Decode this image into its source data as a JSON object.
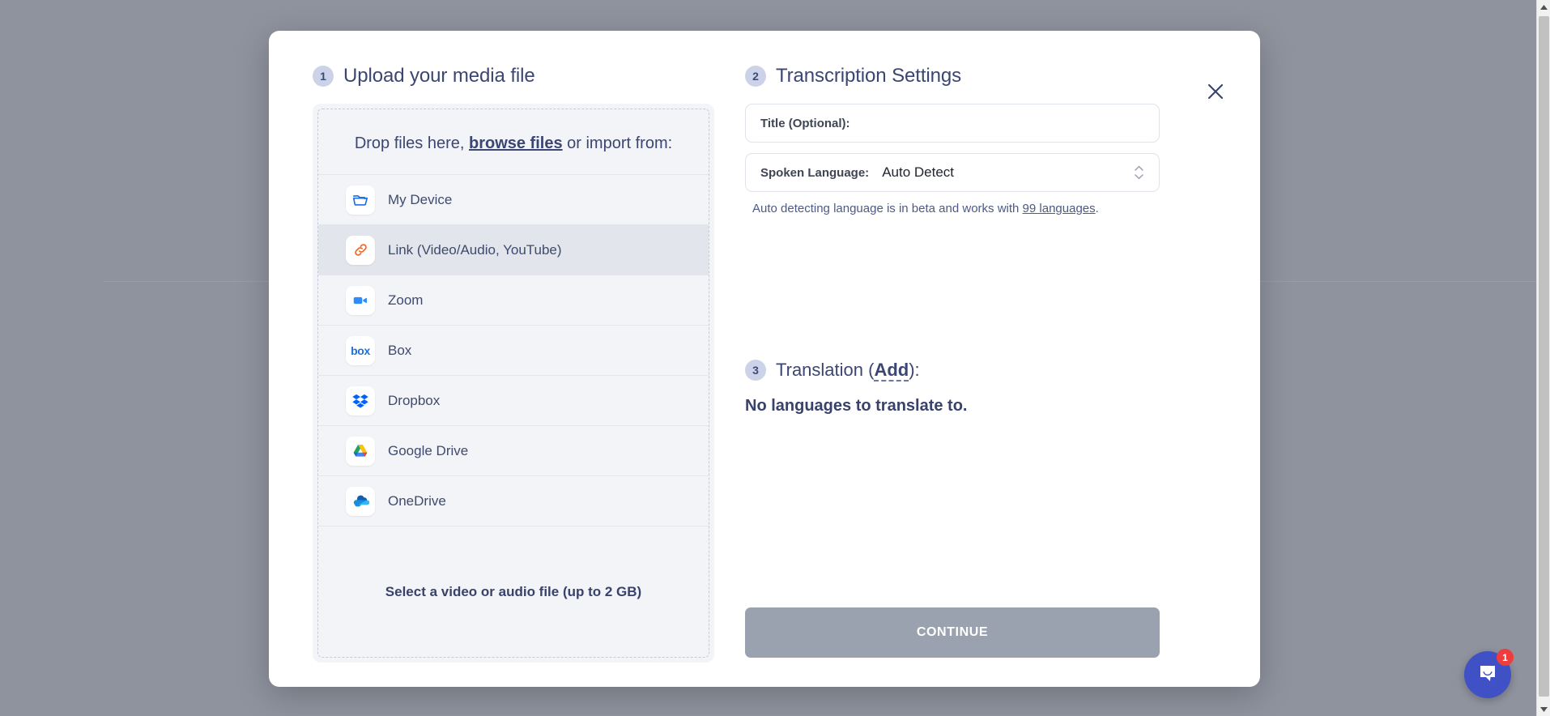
{
  "modal": {
    "close_icon": "close-icon",
    "upload": {
      "step_number": "1",
      "title": "Upload your media file",
      "drop_prefix": "Drop files here, ",
      "browse_label": "browse files",
      "drop_suffix": " or import from:",
      "sources": [
        {
          "label": "My Device",
          "icon": "folder-icon"
        },
        {
          "label": "Link (Video/Audio, YouTube)",
          "icon": "link-icon"
        },
        {
          "label": "Zoom",
          "icon": "zoom-icon"
        },
        {
          "label": "Box",
          "icon": "box-icon",
          "wordmark": "box"
        },
        {
          "label": "Dropbox",
          "icon": "dropbox-icon"
        },
        {
          "label": "Google Drive",
          "icon": "google-drive-icon"
        },
        {
          "label": "OneDrive",
          "icon": "onedrive-icon"
        }
      ],
      "footer_note": "Select a video or audio file (up to 2 GB)"
    },
    "settings": {
      "step_number": "2",
      "title": "Transcription Settings",
      "title_field_label": "Title (Optional):",
      "title_field_value": "",
      "title_field_placeholder": "",
      "language_label": "Spoken Language:",
      "language_value": "Auto Detect",
      "hint_prefix": "Auto detecting language is in beta and works with ",
      "hint_link": "99 languages",
      "hint_suffix": "."
    },
    "translation": {
      "step_number": "3",
      "title_prefix": "Translation (",
      "add_label": "Add",
      "title_suffix": "):",
      "empty_message": "No languages to translate to."
    },
    "continue_label": "CONTINUE"
  },
  "chat": {
    "launcher_icon": "chat-bubble-icon",
    "unread_count": "1"
  },
  "colors": {
    "accent_blue": "#3f51c5",
    "heading_navy": "#3b4672",
    "badge_red": "#f03c3c",
    "disabled_grey": "#9ba2af",
    "backdrop": "#8f939e"
  }
}
